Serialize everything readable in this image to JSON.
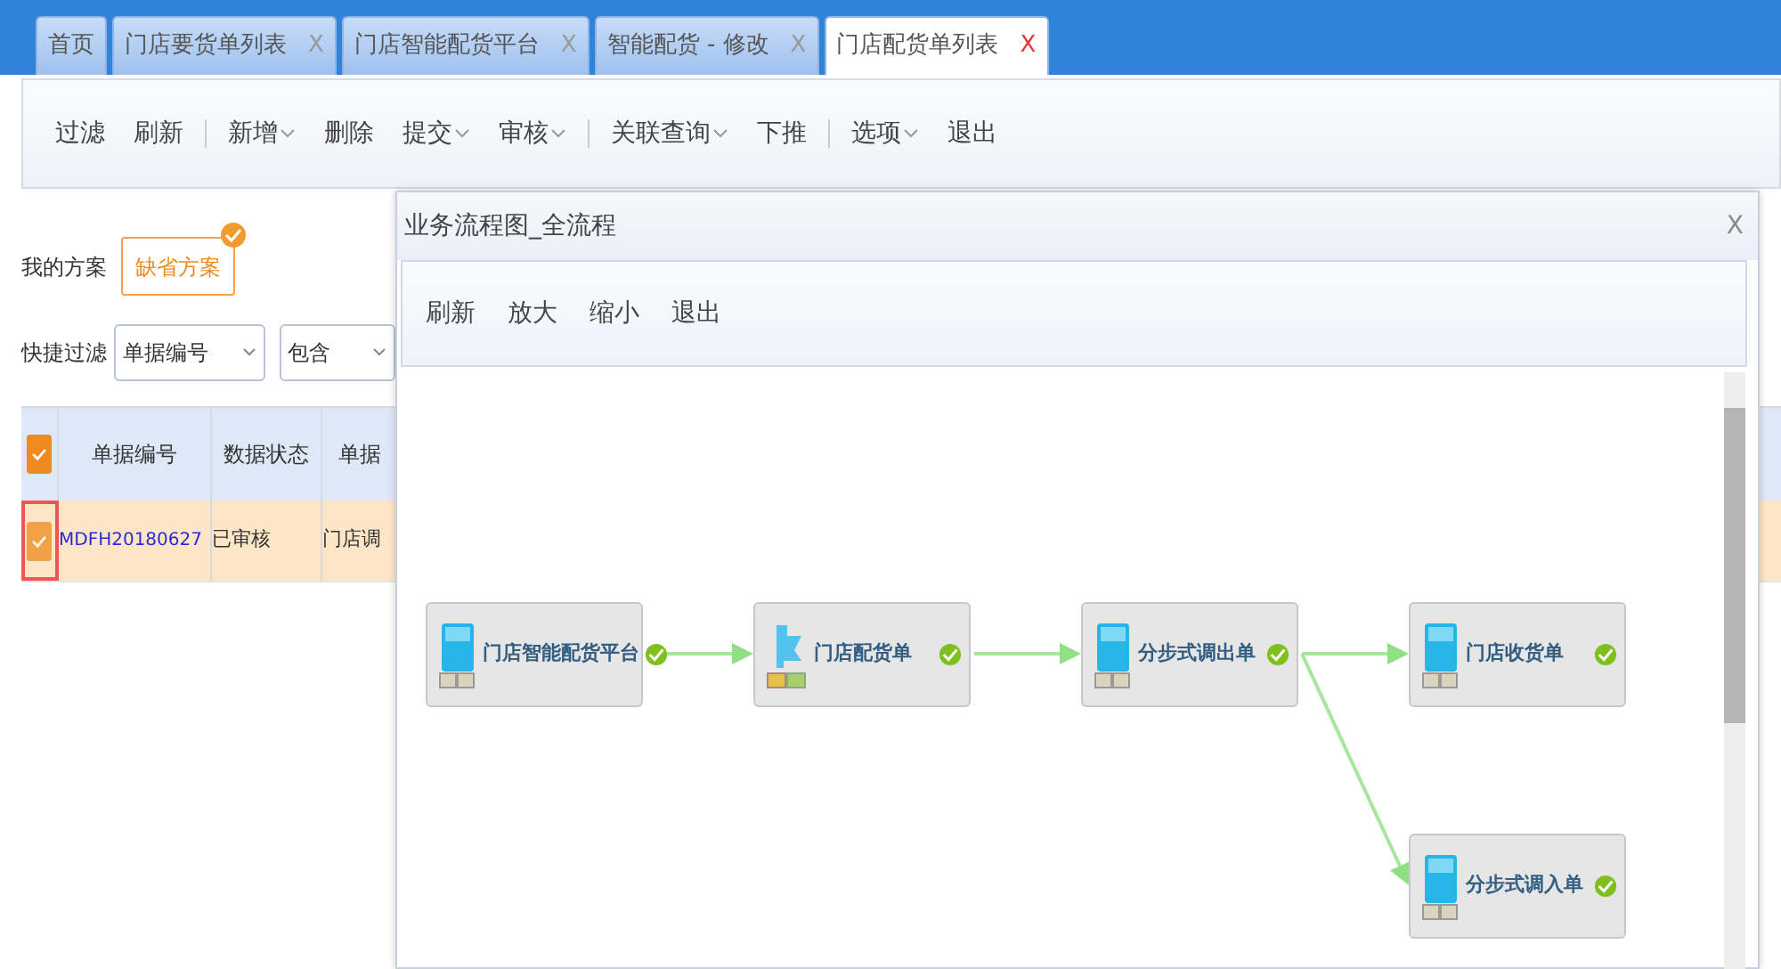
{
  "tabs": [
    {
      "label": "首页",
      "selected": false
    },
    {
      "label": "门店要货单列表",
      "close": "X",
      "selected": false
    },
    {
      "label": "门店智能配货平台",
      "close": "X",
      "selected": false
    },
    {
      "label": "智能配货 - 修改",
      "close": "X",
      "selected": false
    },
    {
      "label": "门店配货单列表",
      "close": "X",
      "selected": true
    }
  ],
  "toolbar": [
    [
      {
        "label": "过滤",
        "dropdown": false
      },
      {
        "label": "刷新",
        "dropdown": false
      }
    ],
    [
      {
        "label": "新增",
        "dropdown": true
      },
      {
        "label": "删除",
        "dropdown": false
      },
      {
        "label": "提交",
        "dropdown": true
      },
      {
        "label": "审核",
        "dropdown": true
      }
    ],
    [
      {
        "label": "关联查询",
        "dropdown": true
      },
      {
        "label": "下推",
        "dropdown": false
      }
    ],
    [
      {
        "label": "选项",
        "dropdown": true
      },
      {
        "label": "退出",
        "dropdown": false
      }
    ]
  ],
  "scheme": {
    "label": "我的方案",
    "items": [
      {
        "label": "缺省方案",
        "selected": true
      }
    ]
  },
  "quick_filter": {
    "label": "快捷过滤",
    "field": "单据编号",
    "operator": "包含"
  },
  "table": {
    "header_checked": true,
    "columns": [
      "单据编号",
      "数据状态",
      "单据"
    ],
    "rows": [
      {
        "checked": true,
        "selected": true,
        "cells": [
          "MDFH20180627",
          "已审核",
          "门店调"
        ]
      }
    ]
  },
  "dialog": {
    "title": "业务流程图_全流程",
    "close": "X",
    "toolbar": [
      "刷新",
      "放大",
      "缩小",
      "退出"
    ],
    "nodes": [
      {
        "label": "门店智能配货平台",
        "kind": "document",
        "done": true,
        "children": [
          {
            "label": "门店配货单",
            "kind": "push",
            "done": true,
            "children": [
              {
                "label": "分步式调出单",
                "kind": "document",
                "done": true,
                "children": [
                  {
                    "label": "门店收货单",
                    "kind": "document",
                    "done": true
                  },
                  {
                    "label": "分步式调入单",
                    "kind": "document",
                    "done": true
                  }
                ]
              }
            ]
          }
        ]
      }
    ]
  }
}
